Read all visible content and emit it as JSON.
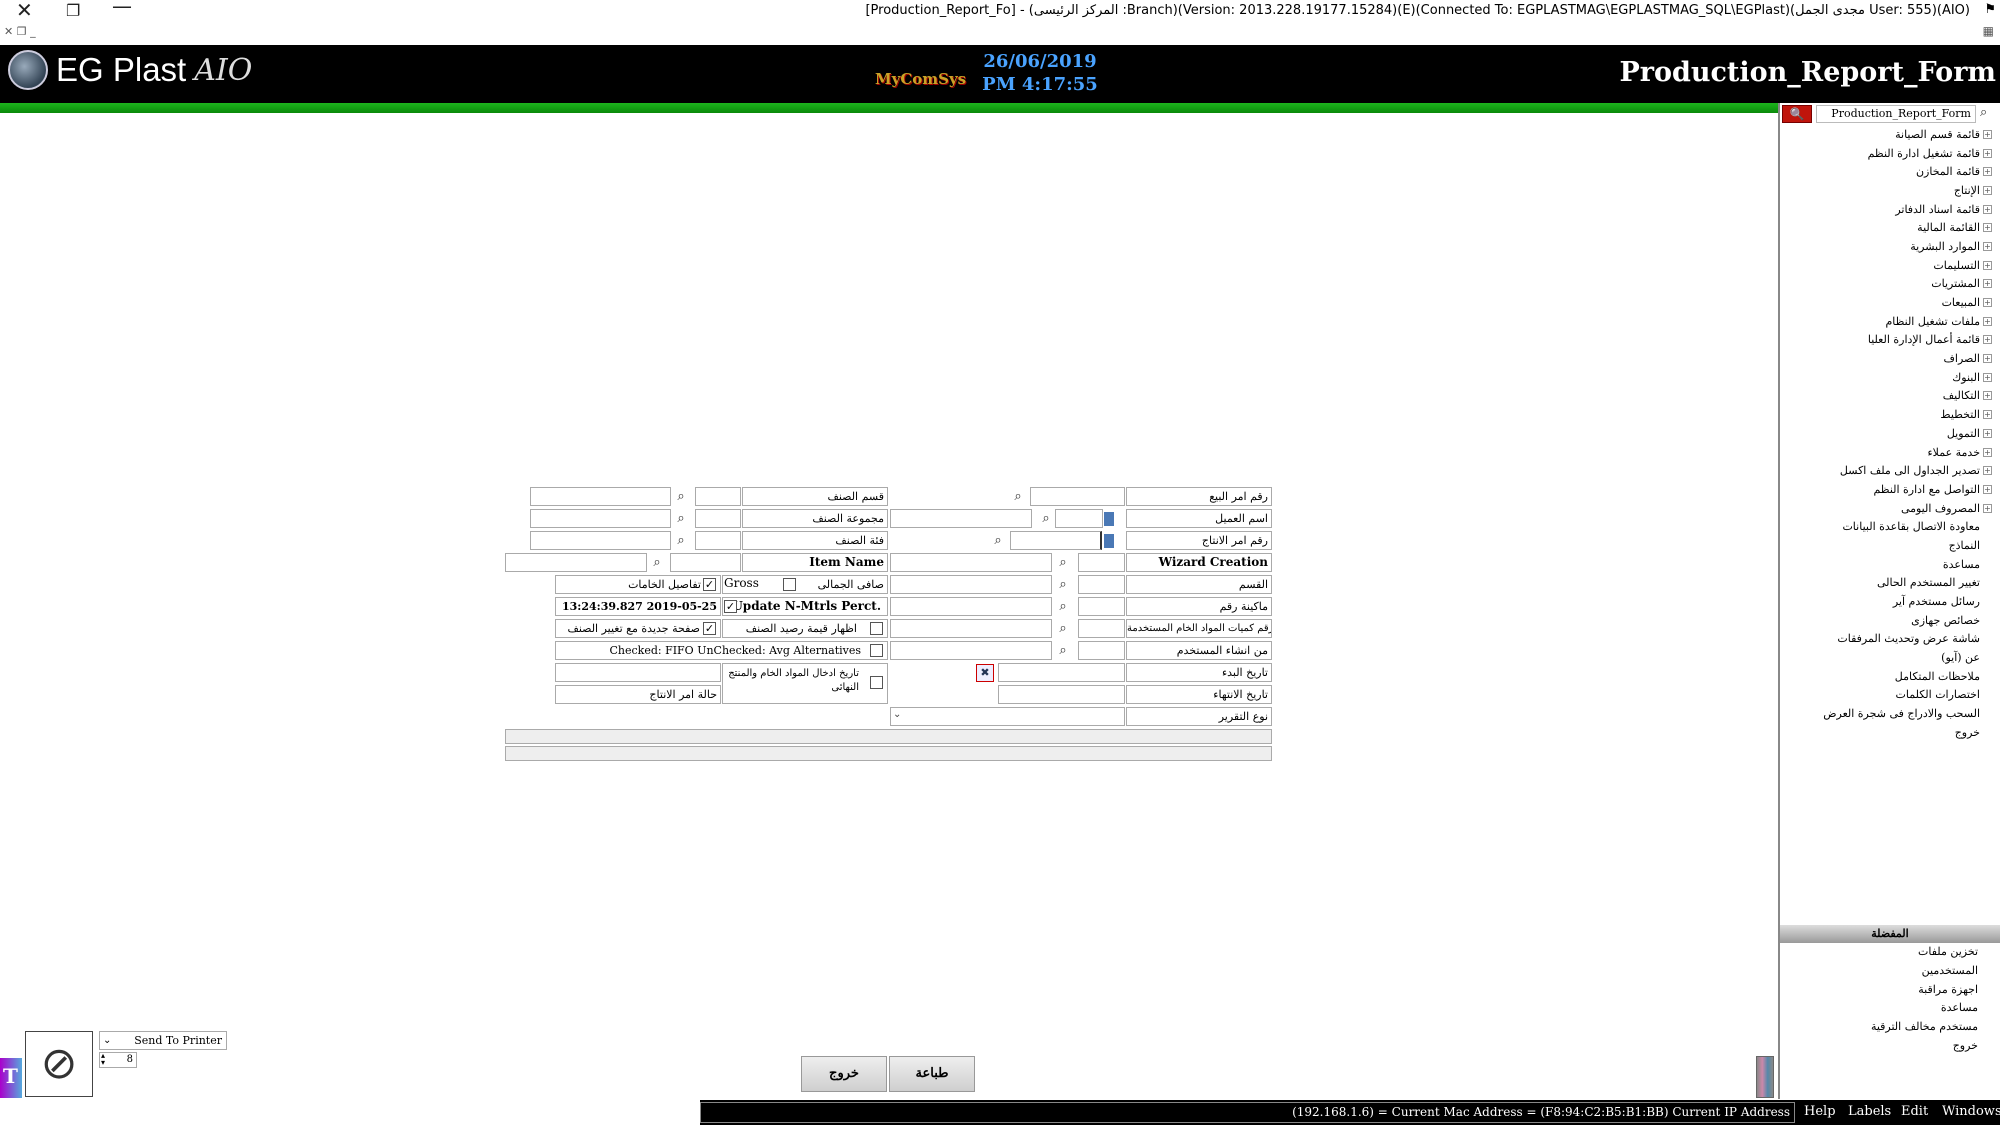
{
  "window": {
    "title": "[Production_Report_Fo] - (المركز الرئيسى :Branch)(Version: 2013.228.19177.15284)(E)(Connected To: EGPLASTMAG\\EGPLASTMAG_SQL\\EGPlast)(مجدى الجمل User: 555)(AIO)"
  },
  "header": {
    "logo_text": "EG Plast",
    "logo_suffix": "AIO",
    "date": "26/06/2019",
    "time": "PM 4:17:55",
    "company_brand": "MyComSys",
    "form_title": "Production_Report_Form"
  },
  "sidebar": {
    "search_value": "Production_Report_Form",
    "tree": [
      {
        "label": "قائمة قسم الصيانة",
        "expand": true
      },
      {
        "label": "قائمة تشغيل ادارة النظم",
        "expand": true
      },
      {
        "label": "قائمة المخازن",
        "expand": true
      },
      {
        "label": "الإنتاج",
        "expand": true
      },
      {
        "label": "قائمة اسناد الدفاتر",
        "expand": true
      },
      {
        "label": "القائمة المالية",
        "expand": true
      },
      {
        "label": "الموارد البشرية",
        "expand": true
      },
      {
        "label": "التسليمات",
        "expand": true
      },
      {
        "label": "المشتريات",
        "expand": true
      },
      {
        "label": "المبيعات",
        "expand": true
      },
      {
        "label": "ملفات تشغيل النظام",
        "expand": true
      },
      {
        "label": "قائمة أعمال الإدارة العليا",
        "expand": true
      },
      {
        "label": "الصراف",
        "expand": true
      },
      {
        "label": "البنوك",
        "expand": true
      },
      {
        "label": "التكاليف",
        "expand": true
      },
      {
        "label": "التخطيط",
        "expand": true
      },
      {
        "label": "التمويل",
        "expand": true
      },
      {
        "label": "خدمة عملاء",
        "expand": true
      },
      {
        "label": "تصدير الجداول الى ملف اكسل",
        "expand": true
      },
      {
        "label": "التواصل مع ادارة النظم",
        "expand": true
      },
      {
        "label": "المصروف اليومى",
        "expand": true
      },
      {
        "label": "معاودة الاتصال بقاعدة البيانات",
        "expand": false
      },
      {
        "label": "النماذج",
        "expand": false
      },
      {
        "label": "مساعدة",
        "expand": false
      },
      {
        "label": "تغيير المستخدم الحالى",
        "expand": false
      },
      {
        "label": "رسائل مستخدم آير",
        "expand": false
      },
      {
        "label": "خصائص جهازى",
        "expand": false
      },
      {
        "label": "شاشة عرض وتحديث المرفقات",
        "expand": false
      },
      {
        "label": "عن (آيو)",
        "expand": false
      },
      {
        "label": "ملاحظات المتكامل",
        "expand": false
      },
      {
        "label": "اختصارات الكلمات",
        "expand": false
      },
      {
        "label": "السحب والادراج فى شجرة العرض",
        "expand": false
      },
      {
        "label": "خروج",
        "expand": false
      }
    ],
    "favorites_header": "المفضلة",
    "favorites": [
      "تخزين ملفات",
      "المستخدمين",
      "اجهزة مراقبة",
      "مساعدة",
      "مستخدم مخالف الترقية",
      "خروج"
    ]
  },
  "form": {
    "labels": {
      "sales_order_no": "رقم امر البيع",
      "customer_name": "اسم العميل",
      "production_order_no": "رقم امر الانتاج",
      "wizard_creation": "Wizard Creation",
      "department": "القسم",
      "machine_no": "ماكينة رقم",
      "raw_material_qty_no": "رقم كميات المواد الخام المستخدمة",
      "created_by_user": "من انشاء المستخدم",
      "start_date": "تاريخ البدء",
      "end_date": "تاريخ الانتهاء",
      "report_type": "نوع التقرير",
      "item_section": "قسم الصنف",
      "item_group": "مجموعة الصنف",
      "item_category": "فئة الصنف",
      "item_name": "Item Name",
      "net_total": "صافى الجمالى",
      "gross": "Gross",
      "material_details": "تفاصيل الخامات",
      "update_nmtrls": "Update N-Mtrls Perct.",
      "update_timestamp": "13:24:39.827 2019-05-25",
      "show_item_balance_value": "اظهار قيمة رصيد الصنف",
      "new_page_per_item": "صفحة جديدة مع تغيير الصنف",
      "fifo_alternatives": "Checked: FIFO UnChecked: Avg Alternatives",
      "raw_final_entry_date": "تاريخ ادخال المواد الخام والمنتج النهائى",
      "production_order_status": "حالة امر الانتاج"
    },
    "checks": {
      "net_total": false,
      "material_details": true,
      "update_nmtrls": true,
      "show_item_balance_value": false,
      "new_page_per_item": true,
      "fifo_alternatives": false,
      "raw_final_entry_date": false
    }
  },
  "buttons": {
    "exit": "خروج",
    "print": "طباعة"
  },
  "printer": {
    "option": "Send To Printer",
    "copies": "8"
  },
  "statusbar": {
    "text": "(192.168.1.6) = Current Mac Address = (F8:94:C2:B5:B1:BB) Current IP Address",
    "menus": [
      "Help",
      "Labels",
      "Edit",
      "Windows"
    ]
  },
  "colors": {
    "header_bg": "#000000",
    "green_bar": "#1db51d",
    "date_blue": "#4aa3ff",
    "search_red": "#c0150c"
  }
}
